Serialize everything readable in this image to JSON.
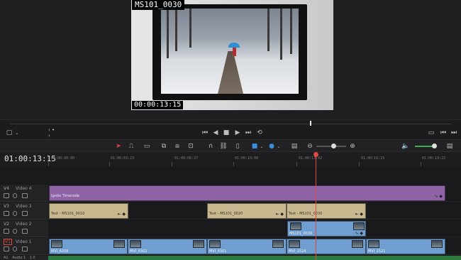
{
  "viewer": {
    "reel_name": "MS101_0030",
    "burned_timecode": "00:00:13:15"
  },
  "timeline": {
    "current_timecode": "01:00:13:15",
    "ruler_labels": [
      "01:00:00:00",
      "01:00:03:23",
      "01:00:06:27",
      "01:00:10:00",
      "01:00:13:02",
      "01:00:16:15",
      "01:00:19:22"
    ]
  },
  "tracks": [
    {
      "id": "V4",
      "name": "Video 4",
      "clips": [
        {
          "label": "Ignite Timecode",
          "color": "purple"
        }
      ]
    },
    {
      "id": "V3",
      "name": "Video 3",
      "clips": [
        {
          "label": "Text - MS101_0010",
          "color": "tan"
        },
        {
          "label": "Text - MS101_0020",
          "color": "tan"
        },
        {
          "label": "Text - MS101_0030",
          "color": "tan"
        }
      ]
    },
    {
      "id": "V2",
      "name": "Video 2",
      "clips": [
        {
          "label": "MS101_0030",
          "color": "blue"
        }
      ]
    },
    {
      "id": "V1",
      "name": "Video 1",
      "clips": [
        {
          "label": "MVI_6308",
          "color": "blue"
        },
        {
          "label": "MVI_6302",
          "color": "blue"
        },
        {
          "label": "MVI_6301",
          "color": "blue"
        },
        {
          "label": "MVI_1524",
          "color": "blue"
        },
        {
          "label": "MVI_1521",
          "color": "blue"
        }
      ]
    },
    {
      "id": "A1",
      "name": "Audio 1",
      "clips": []
    }
  ],
  "audio": {
    "level": "1.0"
  },
  "colors": {
    "playhead": "#e04a3f",
    "purple_clip": "#8e64a5",
    "tan_clip": "#c8b890",
    "blue_clip": "#6f9ed1",
    "audio_clip": "#2f7a3e"
  }
}
